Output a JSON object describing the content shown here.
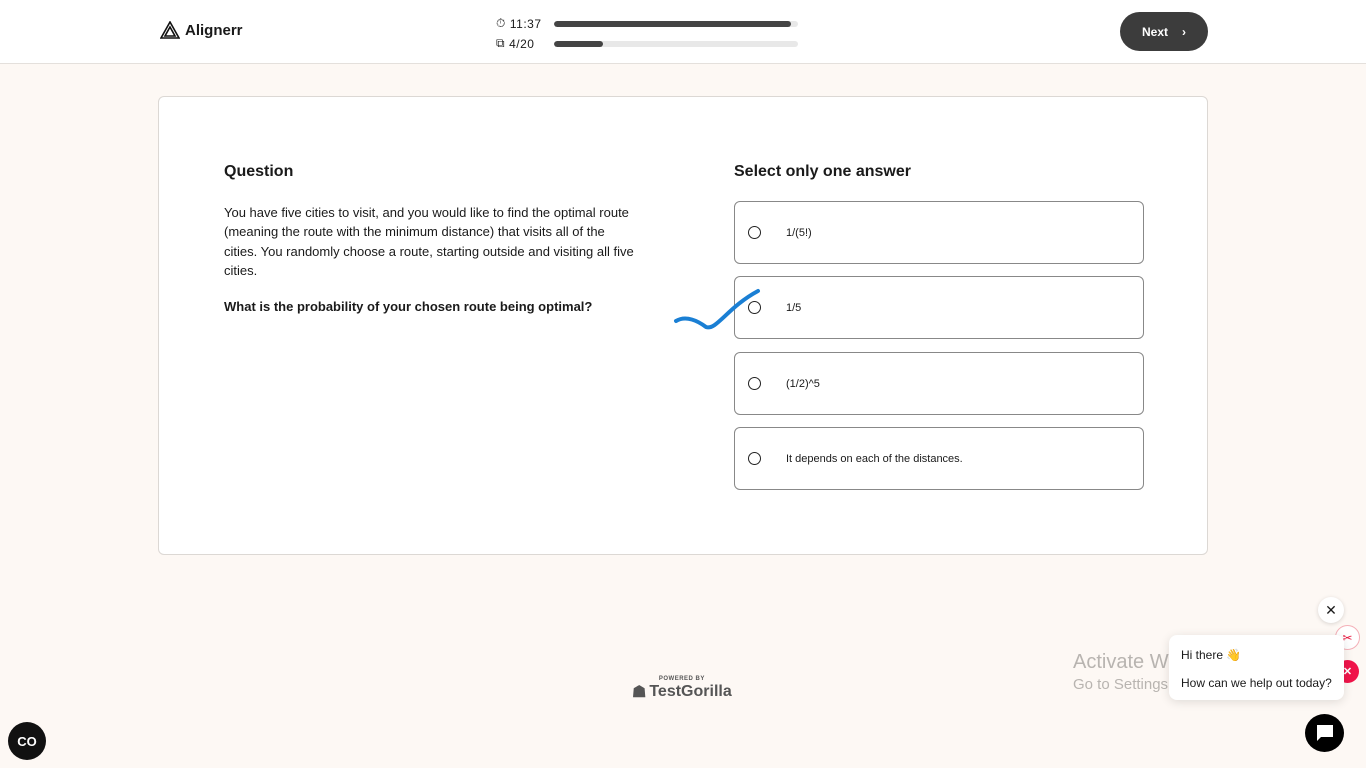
{
  "header": {
    "brand": "Alignerr",
    "timer": "11:37",
    "timer_progress_pct": 97,
    "question_count": "4/20",
    "question_progress_pct": 20,
    "next_label": "Next"
  },
  "question": {
    "title": "Question",
    "text": "You have five cities to visit, and you would like to find the optimal route (meaning the route with the minimum distance) that visits all of the cities. You randomly choose a route, starting outside and visiting all five cities.",
    "prompt": "What is the probability of your chosen route being optimal?"
  },
  "answers": {
    "title": "Select only one answer",
    "options": [
      "1/(5!)",
      "1/5",
      "(1/2)^5",
      "It depends on each of the distances."
    ],
    "annotation": "blue checkmark drawn next to option 2"
  },
  "footer": {
    "powered_by": "POWERED BY",
    "brand": "TestGorilla"
  },
  "watermark": {
    "line1": "Activate Windows",
    "line2": "Go to Settings to activate Windows."
  },
  "chat": {
    "greeting": "Hi there 👋",
    "message": "How can we help out today?",
    "close": "✕"
  },
  "colors": {
    "accent": "#3c3c3c",
    "check": "#1a7fd4",
    "background": "#fdf8f4"
  }
}
